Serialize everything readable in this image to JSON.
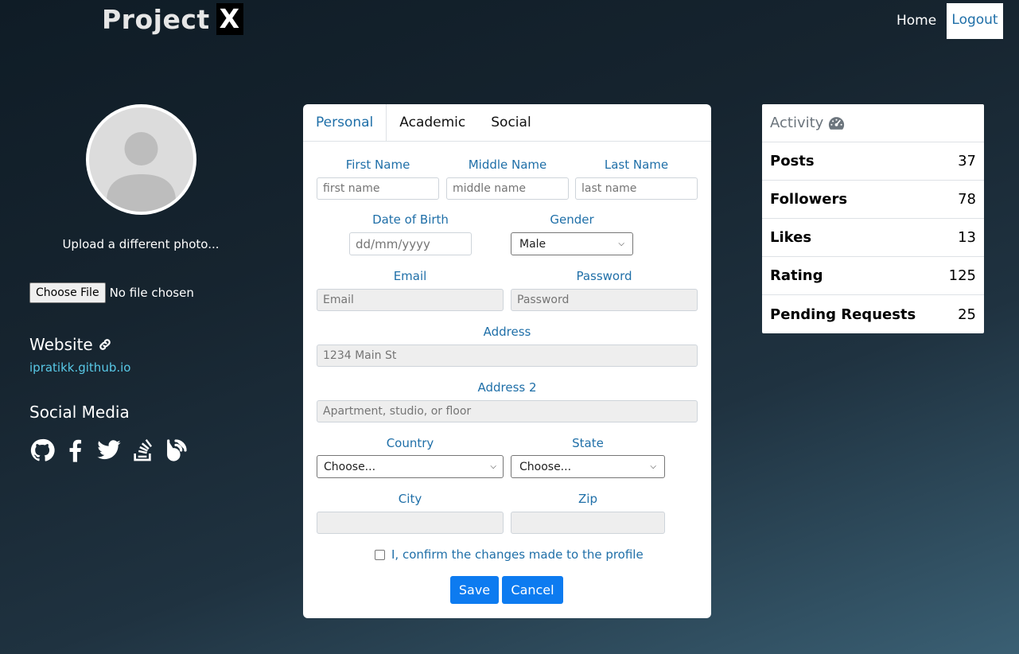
{
  "header": {
    "brand_main": "Project",
    "brand_x": "X",
    "home_label": "Home",
    "logout_label": "Logout"
  },
  "profile": {
    "upload_text": "Upload a different photo...",
    "file_button": "Choose File",
    "file_status": "No file chosen",
    "website_heading": "Website",
    "website_link": "ipratikk.github.io",
    "social_heading": "Social Media",
    "social_icons": [
      "github-icon",
      "facebook-icon",
      "twitter-icon",
      "stackoverflow-icon",
      "blogger-icon"
    ]
  },
  "tabs": [
    {
      "label": "Personal",
      "active": true
    },
    {
      "label": "Academic",
      "active": false
    },
    {
      "label": "Social",
      "active": false
    }
  ],
  "form": {
    "first_name_label": "First Name",
    "first_name_placeholder": "first name",
    "middle_name_label": "Middle Name",
    "middle_name_placeholder": "middle name",
    "last_name_label": "Last Name",
    "last_name_placeholder": "last name",
    "dob_label": "Date of Birth",
    "dob_placeholder": "dd/mm/yyyy",
    "gender_label": "Gender",
    "gender_value": "Male",
    "email_label": "Email",
    "email_placeholder": "Email",
    "password_label": "Password",
    "password_placeholder": "Password",
    "address_label": "Address",
    "address_placeholder": "1234 Main St",
    "address2_label": "Address 2",
    "address2_placeholder": "Apartment, studio, or floor",
    "country_label": "Country",
    "country_value": "Choose...",
    "state_label": "State",
    "state_value": "Choose...",
    "city_label": "City",
    "city_value": "",
    "zip_label": "Zip",
    "zip_value": "",
    "confirm_label": "I, confirm the changes made to the profile",
    "save_label": "Save",
    "cancel_label": "Cancel"
  },
  "activity": {
    "title": "Activity",
    "icon": "gauge-icon",
    "rows": [
      {
        "label": "Posts",
        "value": "37"
      },
      {
        "label": "Followers",
        "value": "78"
      },
      {
        "label": "Likes",
        "value": "13"
      },
      {
        "label": "Rating",
        "value": "125"
      },
      {
        "label": "Pending Requests",
        "value": "25"
      }
    ]
  },
  "colors": {
    "accent": "#1f6fa8",
    "button": "#0d7bf0",
    "link": "#58c8e6"
  }
}
